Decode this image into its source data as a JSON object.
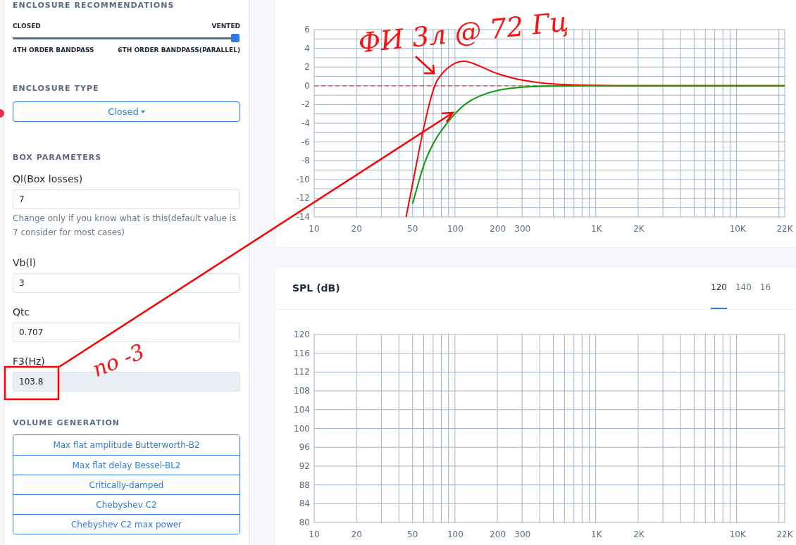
{
  "sidebar": {
    "recommendations": {
      "title": "ENCLOSURE RECOMMENDATIONS",
      "left_top": "CLOSED",
      "right_top": "VENTED",
      "left_bottom": "4TH ORDER BANDPASS",
      "right_bottom": "6TH ORDER BANDPASS(PARALLEL)",
      "level": 1
    },
    "enclosure_type": {
      "title": "ENCLOSURE TYPE",
      "value": "Closed"
    },
    "box_parameters": {
      "title": "BOX PARAMETERS",
      "fields": [
        {
          "label": "Ql(Box losses)",
          "value": "7",
          "help": "Change only if you know what is this(default value is 7 consider for most cases)",
          "readonly": false
        },
        {
          "label": "Vb(l)",
          "value": "3",
          "readonly": false
        },
        {
          "label": "Qtc",
          "value": "0.707",
          "readonly": false
        },
        {
          "label": "F3(Hz)",
          "value": "103.8",
          "readonly": true
        }
      ]
    },
    "volume_generation": {
      "title": "VOLUME GENERATION",
      "buttons": [
        "Max flat amplitude Butterworth-B2",
        "Max flat delay Bessel-BL2",
        "Critically-damped",
        "Chebyshev C2",
        "Chebyshev C2 max power"
      ]
    }
  },
  "response_chart": {
    "x_labels": [
      "10",
      "20",
      "50",
      "100",
      "200",
      "300",
      "1K",
      "2K",
      "10K",
      "22K"
    ],
    "y_labels": [
      "6",
      "4",
      "2",
      "0",
      "-2",
      "-4",
      "-6",
      "-8",
      "-10",
      "-12",
      "-14"
    ]
  },
  "spl_chart": {
    "title": "SPL (dB)",
    "tabs": [
      {
        "label": "120",
        "selected": true
      },
      {
        "label": "140",
        "selected": false
      },
      {
        "label": "16",
        "selected": false
      }
    ],
    "x_labels": [
      "10",
      "20",
      "50",
      "100",
      "200",
      "300",
      "1K",
      "2K",
      "10K",
      "22K"
    ],
    "y_labels": [
      "120",
      "116",
      "112",
      "108",
      "104",
      "100",
      "96",
      "92",
      "88",
      "84",
      "80"
    ]
  },
  "handwritten_notes": [
    {
      "text": "ФИ 3л @ 72 Гц"
    },
    {
      "text": "no -3"
    }
  ]
}
